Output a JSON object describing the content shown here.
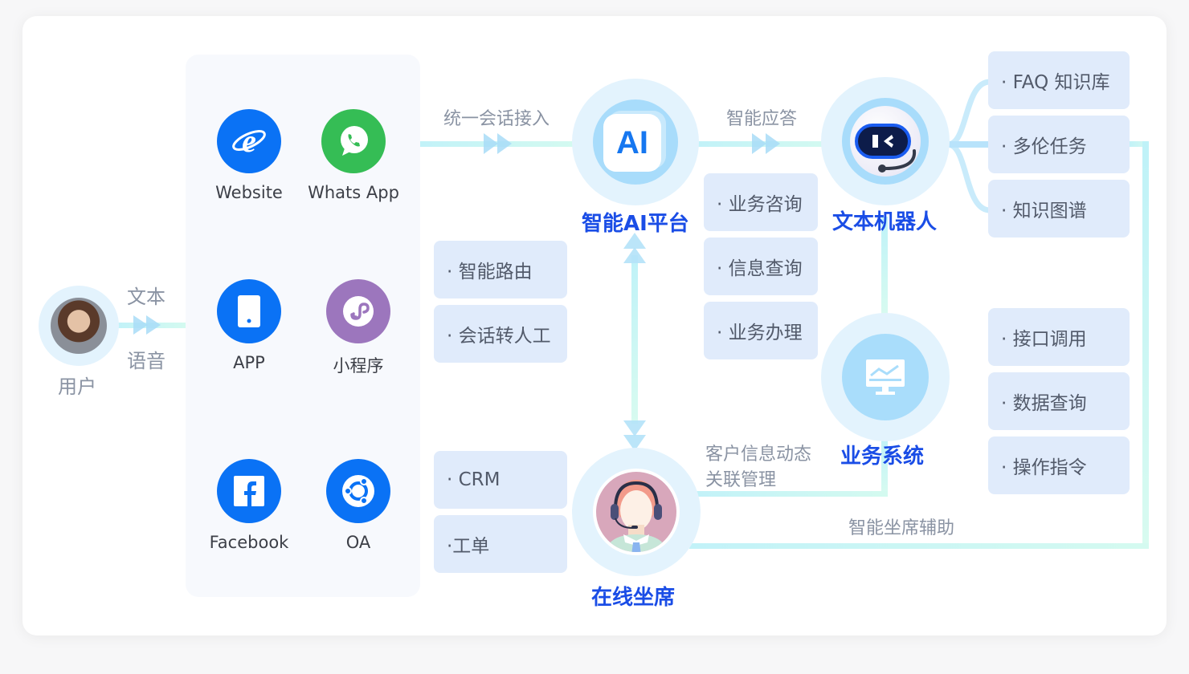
{
  "user": {
    "label": "用户",
    "input_modes": [
      "文本",
      "语音"
    ]
  },
  "channels": [
    {
      "label": "Website",
      "icon": "ie-browser-icon",
      "color": "#0a72f5"
    },
    {
      "label": "Whats App",
      "icon": "whatsapp-icon",
      "color": "#35bd55"
    },
    {
      "label": "APP",
      "icon": "mobile-phone-icon",
      "color": "#0a72f5"
    },
    {
      "label": "小程序",
      "icon": "mini-program-icon",
      "color": "#9c76bd"
    },
    {
      "label": "Facebook",
      "icon": "facebook-icon",
      "color": "#0a72f5"
    },
    {
      "label": "OA",
      "icon": "oa-icon",
      "color": "#0a72f5"
    }
  ],
  "flows": {
    "unified_access": "统一会话接入",
    "smart_answer": "智能应答",
    "customer_info": [
      "客户信息动态",
      "关联管理"
    ],
    "agent_assist": "智能坐席辅助"
  },
  "nodes": {
    "ai_platform": {
      "title": "智能AI平台",
      "icon_text": "AI"
    },
    "text_robot": {
      "title": "文本机器人"
    },
    "business_system": {
      "title": "业务系统"
    },
    "online_agent": {
      "title": "在线坐席"
    }
  },
  "tags": {
    "routing": [
      "· 智能路由",
      "· 会话转人工"
    ],
    "agent_tools": [
      "· CRM",
      "·工单"
    ],
    "robot_business": [
      "· 业务咨询",
      "· 信息查询",
      "· 业务办理"
    ],
    "knowledge": [
      "· FAQ 知识库",
      "· 多伦任务",
      "· 知识图谱"
    ],
    "system_ops": [
      "· 接口调用",
      "· 数据查询",
      "· 操作指令"
    ]
  },
  "colors": {
    "title_blue": "#1a4de6",
    "tag_bg": "#e0ebfb",
    "line_cyan": "#c6f4f6",
    "halo": "#e3f3fd"
  }
}
